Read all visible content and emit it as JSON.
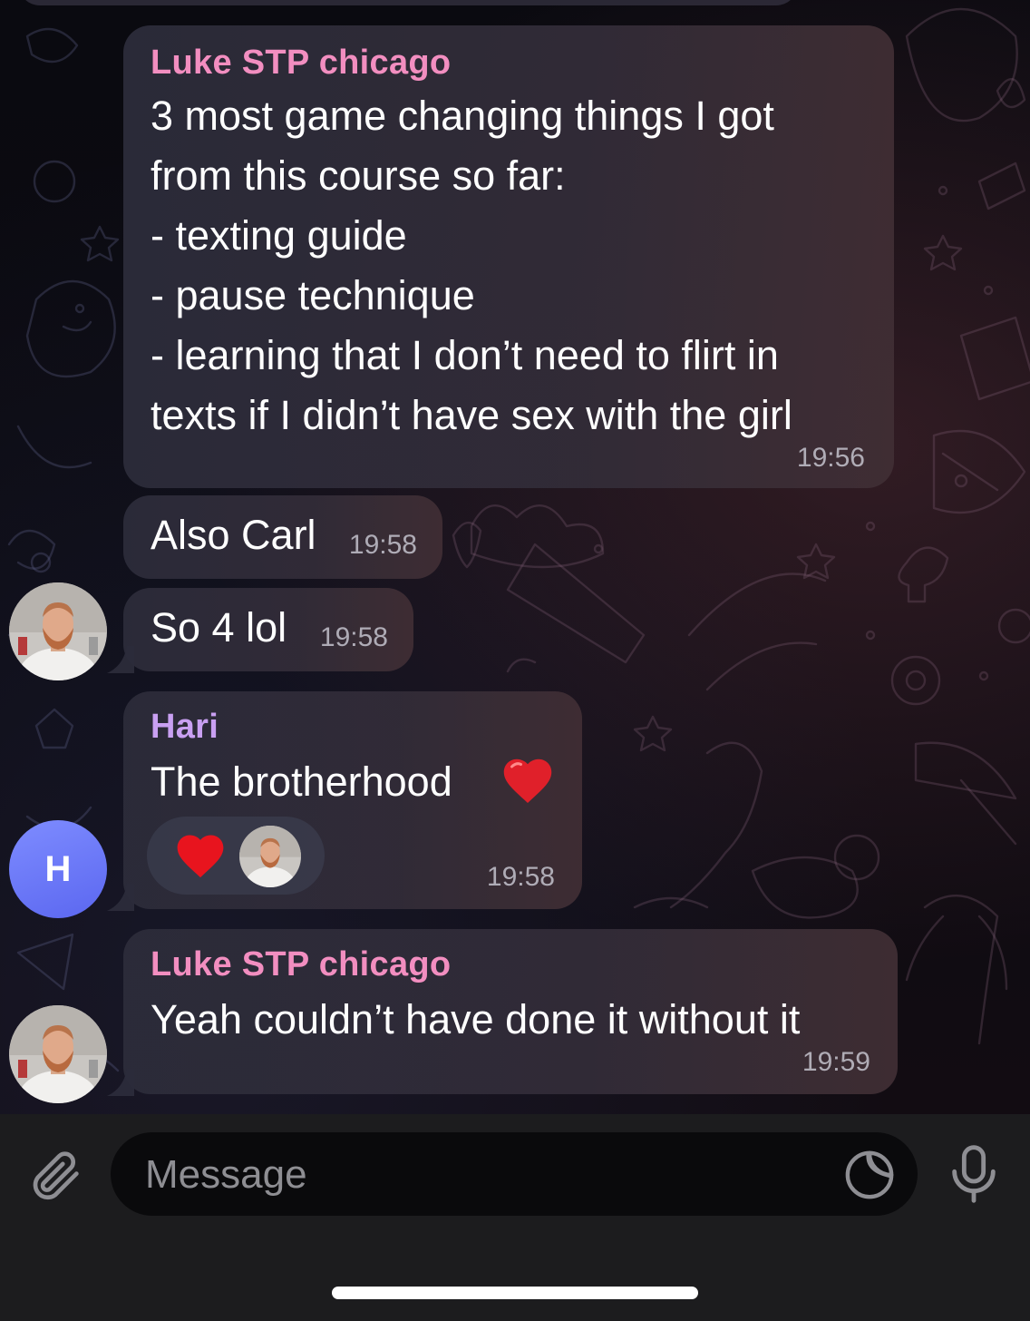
{
  "colors": {
    "sender_luke": "#f28ec0",
    "sender_hari": "#c9a0f2",
    "bubble": "#2c2c3a",
    "avatar_h": "#6b77f5",
    "input_bar": "#1c1c1e"
  },
  "messages": [
    {
      "sender": "Luke STP chicago",
      "lines": [
        "3 most game changing things I got",
        "from this course so far:",
        "- texting guide",
        "- pause technique",
        "- learning that I don’t need to flirt in",
        "texts if I didn’t have sex with the girl"
      ],
      "time": "19:56"
    },
    {
      "text": "Also Carl",
      "time": "19:58"
    },
    {
      "text": "So 4 lol",
      "time": "19:58"
    },
    {
      "sender": "Hari",
      "text": "The brotherhood",
      "emoji": "heart",
      "time": "19:58",
      "reactions": [
        {
          "type": "heart-icon"
        },
        {
          "type": "reactor-avatar"
        }
      ]
    },
    {
      "sender": "Luke STP chicago",
      "text": "Yeah couldn’t have done it without it",
      "time": "19:59"
    }
  ],
  "avatars": {
    "hari_letter": "H"
  },
  "input": {
    "placeholder": "Message",
    "icons": [
      "paperclip-icon",
      "sticker-icon",
      "microphone-icon"
    ]
  }
}
